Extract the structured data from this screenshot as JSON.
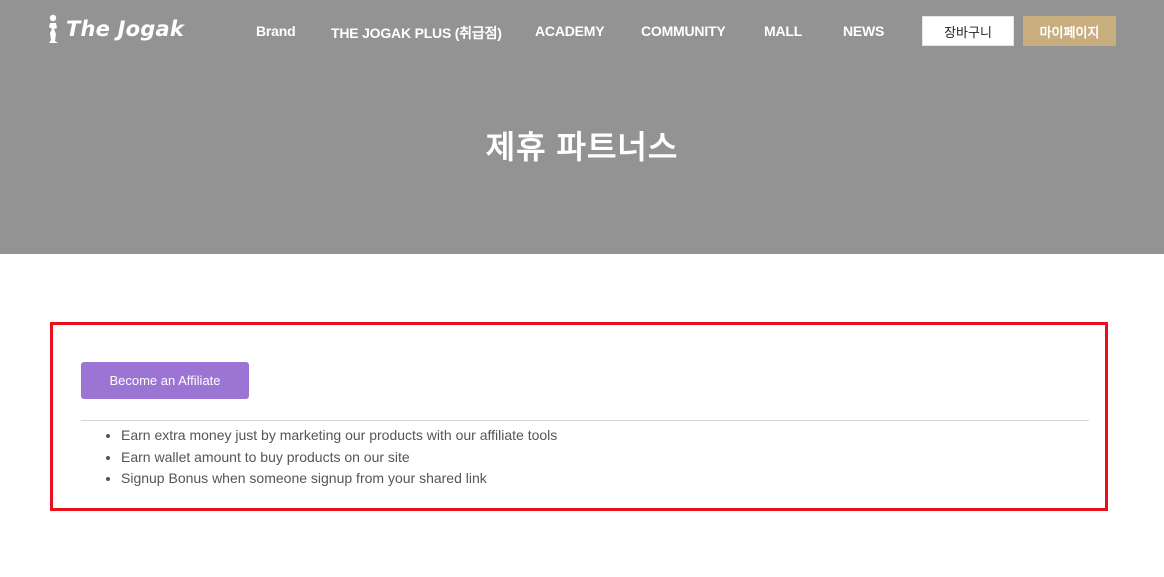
{
  "header": {
    "logo_text": "The Jogak",
    "nav": [
      {
        "label": "Brand"
      },
      {
        "label": "THE JOGAK PLUS (취급점)"
      },
      {
        "label": "ACADEMY"
      },
      {
        "label": "COMMUNITY"
      },
      {
        "label": "MALL"
      },
      {
        "label": "NEWS"
      }
    ],
    "cart_label": "장바구니",
    "mypage_label": "마이페이지"
  },
  "hero": {
    "title": "제휴 파트너스"
  },
  "affiliate": {
    "button_label": "Become an Affiliate",
    "benefits": [
      "Earn extra money just by marketing our products with our affiliate tools",
      "Earn wallet amount to buy products on our site",
      "Signup Bonus when someone signup from your shared link"
    ]
  },
  "colors": {
    "hero_bg": "#939393",
    "mypage_bg": "#c8ad7f",
    "affiliate_button": "#9b74d4",
    "highlight_border": "#e8101a"
  }
}
